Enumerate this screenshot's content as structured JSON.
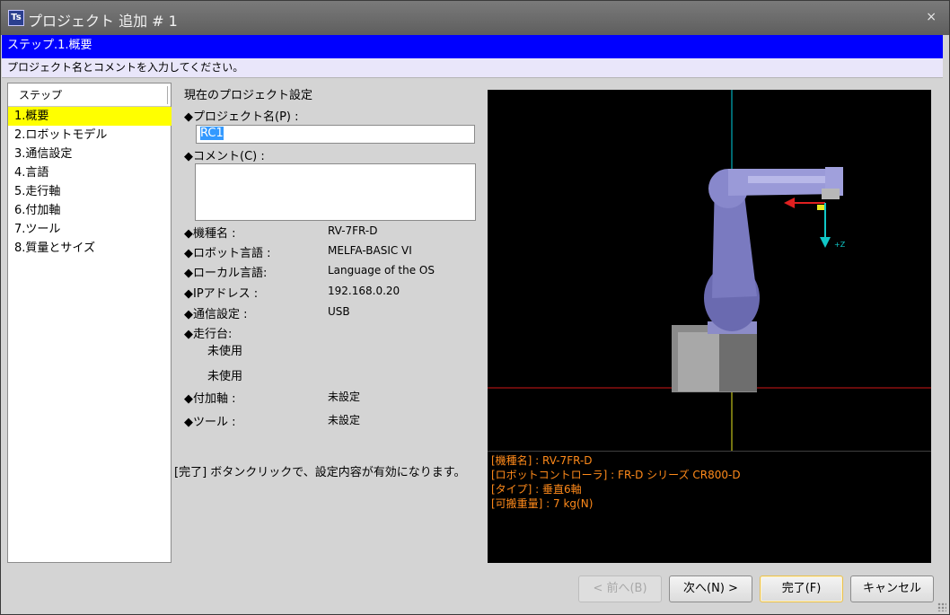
{
  "window": {
    "title": "プロジェクト 追加 # 1",
    "app_icon_text": "Ts",
    "close_label": "×"
  },
  "banner": {
    "step_title": "ステップ.1.概要"
  },
  "instruction": "プロジェクト名とコメントを入力してください。",
  "steps": {
    "header": "ステップ",
    "items": [
      {
        "label": "1.概要",
        "active": true
      },
      {
        "label": "2.ロボットモデル",
        "active": false
      },
      {
        "label": "3.通信設定",
        "active": false
      },
      {
        "label": "4.言語",
        "active": false
      },
      {
        "label": "5.走行軸",
        "active": false
      },
      {
        "label": "6.付加軸",
        "active": false
      },
      {
        "label": "7.ツール",
        "active": false
      },
      {
        "label": "8.質量とサイズ",
        "active": false
      }
    ]
  },
  "settings": {
    "heading": "現在のプロジェクト設定",
    "project_name_label": "◆プロジェクト名(P) :",
    "project_name_value": "RC1",
    "comment_label": "◆コメント(C) :",
    "comment_value": "",
    "model_label": "◆機種名 :",
    "model_value": "RV-7FR-D",
    "robot_lang_label": "◆ロボット言語 :",
    "robot_lang_value": "MELFA-BASIC VI",
    "local_lang_label": "◆ローカル言語:",
    "local_lang_value": "Language of the OS",
    "ip_label": "◆IPアドレス :",
    "ip_value": "192.168.0.20",
    "comm_label": "◆通信設定 :",
    "comm_value": "USB",
    "travel_label": "◆走行台:",
    "travel_sub1": "未使用",
    "travel_sub2": "未使用",
    "addaxis_label": "◆付加軸 :",
    "addaxis_value": "未設定",
    "tool_label": "◆ツール :",
    "tool_value": "未設定",
    "footer_note": "[完了] ボタンクリックで、設定内容が有効になります。"
  },
  "viewer": {
    "axis_label": "+Z",
    "info_lines": [
      "[機種名] : RV-7FR-D",
      "[ロボットコントローラ] : FR-D シリーズ CR800-D",
      "[タイプ] : 垂直6軸",
      "[可搬重量] : 7 kg(N)"
    ]
  },
  "buttons": {
    "prev": "< 前へ(B)",
    "next": "次へ(N) >",
    "finish": "完了(F)",
    "cancel": "キャンセル"
  },
  "colors": {
    "banner": "#0000ff",
    "instruction_bg": "#e9e6fa",
    "active_step": "#ffff00",
    "info_text": "#ff8a1a",
    "selection": "#3399ff"
  }
}
